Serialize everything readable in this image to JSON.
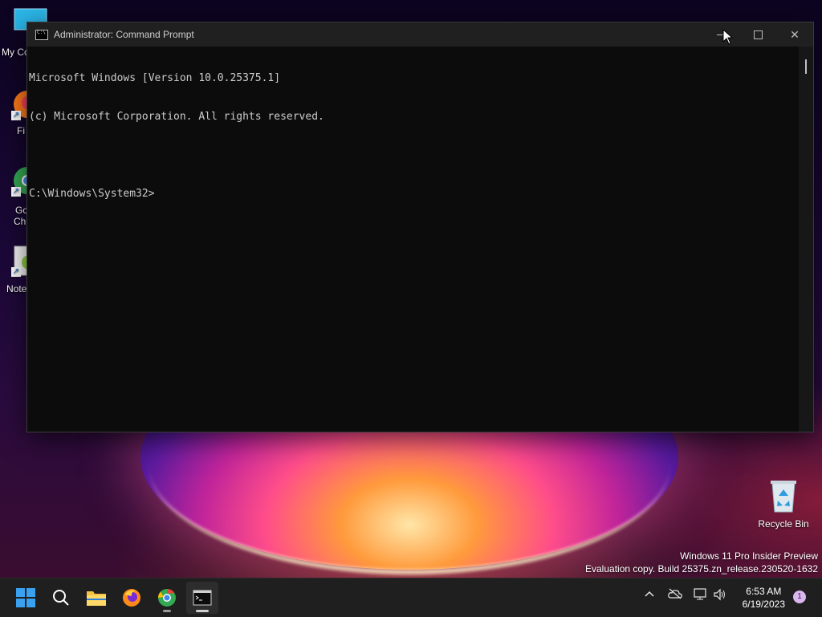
{
  "desktop": {
    "icons": [
      {
        "label": "My Cc"
      },
      {
        "label": "Fi"
      },
      {
        "label": "Go",
        "label2": "Chi"
      },
      {
        "label": "Note"
      }
    ],
    "recycle_bin": {
      "label": "Recycle Bin"
    },
    "watermark": {
      "line1": "Windows 11 Pro Insider Preview",
      "line2": "Evaluation copy. Build 25375.zn_release.230520-1632"
    }
  },
  "window": {
    "title": "Administrator: Command Prompt",
    "console_lines": [
      "Microsoft Windows [Version 10.0.25375.1]",
      "(c) Microsoft Corporation. All rights reserved.",
      "",
      "C:\\Windows\\System32>"
    ]
  },
  "taskbar": {
    "apps": [
      "start-icon",
      "search-icon",
      "file-explorer-icon",
      "firefox-icon",
      "chrome-icon",
      "command-prompt-icon"
    ],
    "clock": {
      "time": "6:53 AM",
      "date": "6/19/2023"
    },
    "notification_count": "1"
  },
  "colors": {
    "console_bg": "#0c0c0c",
    "console_text": "#cccccc",
    "titlebar": "#202020",
    "taskbar": "#1f1f1f"
  }
}
